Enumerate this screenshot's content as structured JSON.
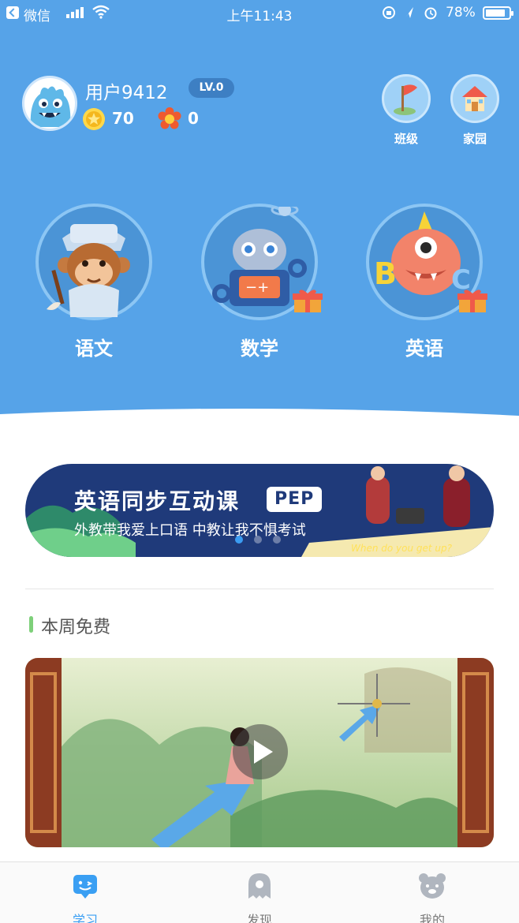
{
  "status_bar": {
    "carrier": "微信",
    "time": "上午11:43",
    "battery": "78%"
  },
  "user": {
    "name": "用户9412",
    "level": "LV.0",
    "coins": "70",
    "flowers": "0"
  },
  "quick_links": [
    {
      "label": "班级",
      "icon": "flag-icon"
    },
    {
      "label": "家园",
      "icon": "house-icon"
    }
  ],
  "subjects": [
    {
      "label": "语文",
      "icon": "monkey-scholar-icon"
    },
    {
      "label": "数学",
      "icon": "robot-icon"
    },
    {
      "label": "英语",
      "icon": "monster-icon"
    }
  ],
  "banner": {
    "title": "英语同步互动课",
    "tag": "PEP",
    "subtitle": "外教带我爱上口语   中教让我不惧考试",
    "caption": "When do you get up?",
    "slide_count": 3,
    "active_slide": 1
  },
  "section": {
    "title": "本周免费"
  },
  "tabs": [
    {
      "label": "学习",
      "icon": "learn-icon",
      "active": true
    },
    {
      "label": "发现",
      "icon": "discover-icon",
      "active": false
    },
    {
      "label": "我的",
      "icon": "bear-icon",
      "active": false
    }
  ],
  "colors": {
    "hero_bg": "#56a3e8",
    "accent": "#3a9ff3",
    "section_bar": "#7ed07a",
    "banner_bg": "#1f3a7a"
  }
}
